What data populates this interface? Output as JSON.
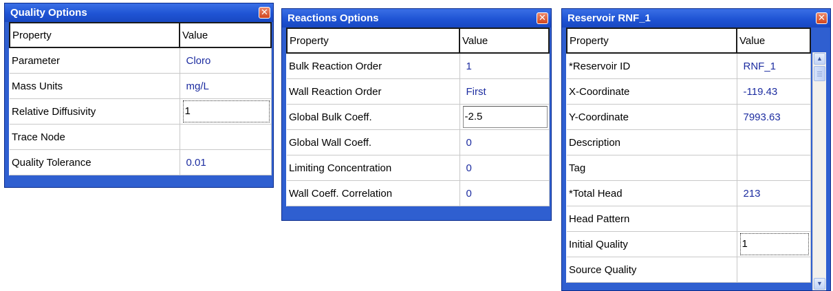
{
  "windows": {
    "quality": {
      "title": "Quality Options",
      "header": {
        "property": "Property",
        "value": "Value"
      },
      "rows": [
        {
          "property": "Parameter",
          "value": "Cloro"
        },
        {
          "property": "Mass Units",
          "value": "mg/L"
        },
        {
          "property": "Relative Diffusivity",
          "value": "1"
        },
        {
          "property": "Trace Node",
          "value": ""
        },
        {
          "property": "Quality Tolerance",
          "value": "0.01"
        }
      ]
    },
    "reactions": {
      "title": "Reactions Options",
      "header": {
        "property": "Property",
        "value": "Value"
      },
      "rows": [
        {
          "property": "Bulk Reaction Order",
          "value": "1"
        },
        {
          "property": "Wall Reaction Order",
          "value": "First"
        },
        {
          "property": "Global Bulk Coeff.",
          "value": "-2.5"
        },
        {
          "property": "Global Wall Coeff.",
          "value": "0"
        },
        {
          "property": "Limiting Concentration",
          "value": "0"
        },
        {
          "property": "Wall Coeff. Correlation",
          "value": "0"
        }
      ]
    },
    "reservoir": {
      "title": "Reservoir RNF_1",
      "header": {
        "property": "Property",
        "value": "Value"
      },
      "rows": [
        {
          "property": "*Reservoir ID",
          "value": "RNF_1"
        },
        {
          "property": "X-Coordinate",
          "value": "-119.43"
        },
        {
          "property": "Y-Coordinate",
          "value": "7993.63"
        },
        {
          "property": "Description",
          "value": ""
        },
        {
          "property": "Tag",
          "value": ""
        },
        {
          "property": "*Total Head",
          "value": "213"
        },
        {
          "property": "Head Pattern",
          "value": ""
        },
        {
          "property": "Initial Quality",
          "value": "1"
        },
        {
          "property": "Source Quality",
          "value": ""
        }
      ]
    }
  },
  "icons": {
    "close": "close-icon",
    "scroll_up": "scroll-up-arrow-icon",
    "scroll_down": "scroll-down-arrow-icon"
  },
  "colors": {
    "titlebar": "#2155d6",
    "close_button": "#d9542c",
    "value_text": "#1c2ca0"
  }
}
